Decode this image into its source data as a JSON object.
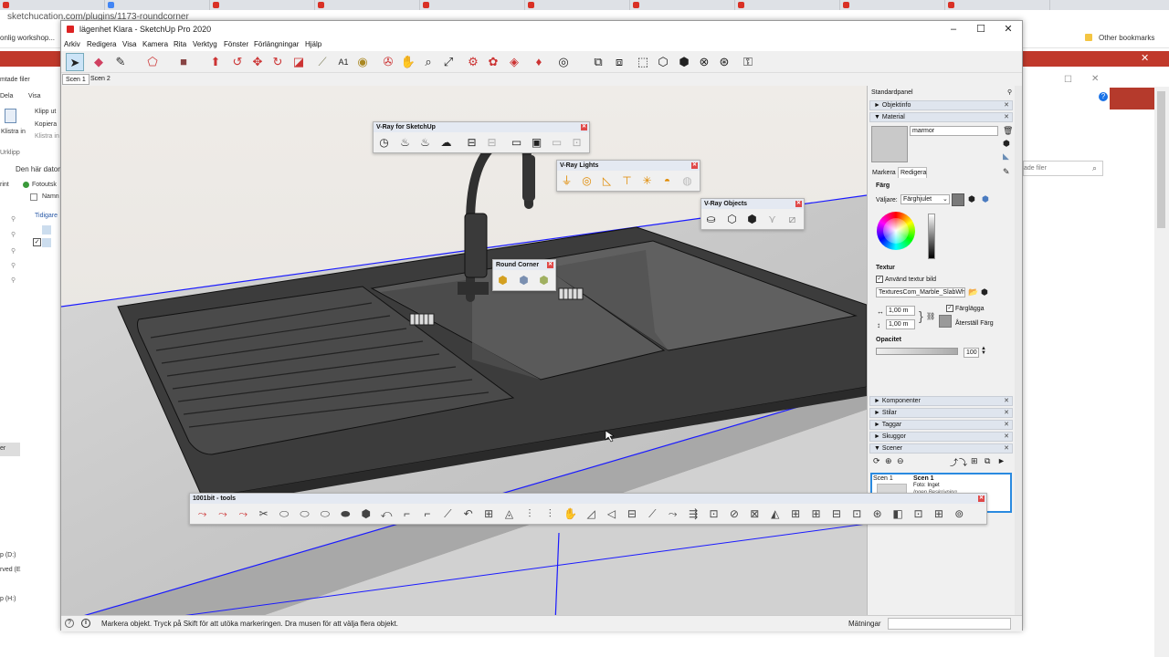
{
  "browser": {
    "url": "sketchucation.com/plugins/1173-roundcorner",
    "bookmarks_left": "onlig workshop...",
    "bookmarks_right": "Other bookmarks"
  },
  "explorer": {
    "header": "mtade filer",
    "ribbon_dela": "Dela",
    "ribbon_visa": "Visa",
    "klistra": "Klistra in",
    "klipp": "Klipp ut",
    "kopiera": "Kopiera",
    "klistra_in2": "Klistra in",
    "urklipp": "Urklipp",
    "den_har_datorn": "Den här dator",
    "rint": "rint",
    "fotoutsk": "Fotoutsk",
    "namn": "Namn",
    "tidigare": "Tidigare",
    "drive_d": "p (D:)",
    "drive_e": "rved (E",
    "drive_h": "p (H:)",
    "er": "er"
  },
  "right_bg": {
    "search_placeholder": "ade filer"
  },
  "sketchup": {
    "title": "lägenhet Klara - SketchUp Pro 2020",
    "menu": [
      "Arkiv",
      "Redigera",
      "Visa",
      "Kamera",
      "Rita",
      "Verktyg",
      "Fönster",
      "Förlängningar",
      "Hjälp"
    ],
    "scenes": [
      "Scen 1",
      "Scen 2"
    ],
    "status_text": "Markera objekt. Tryck på Skift för att utöka markeringen. Dra musen för att välja flera objekt.",
    "measurements_label": "Mätningar"
  },
  "toolbars": {
    "vray": "V-Ray for SketchUp",
    "vray_lights": "V-Ray Lights",
    "vray_objects": "V-Ray Objects",
    "round_corner": "Round Corner",
    "bit_tools": "1001bit - tools"
  },
  "tray": {
    "title": "Standardpanel",
    "sections_top": [
      "Objektinfo",
      "Material"
    ],
    "material_name": "marmor",
    "tabs": [
      "Markera",
      "Redigera"
    ],
    "farg_label": "Färg",
    "valjare_label": "Väljare:",
    "valjare_value": "Färghjulet",
    "textur_label": "Textur",
    "use_texture": "Använd textur bild",
    "texture_file": "TexturesCom_Marble_SlabWh",
    "width": "1,00 m",
    "height": "1,00 m",
    "fargagga": "Färglägga",
    "aterstall": "Återställ Färg",
    "opacitet": "Opacitet",
    "opacity_value": "100",
    "sections_bottom": [
      "Komponenter",
      "Stilar",
      "Taggar",
      "Skuggor",
      "Scener"
    ],
    "scene_card": {
      "thumb_label": "Scen 1",
      "name": "Scen 1",
      "foto": "Foto: Inget",
      "desc": "Ingen Beskrivning"
    }
  },
  "colors": {
    "title_red": "#c0392b",
    "toolbar_header": "#e4e9f2",
    "selection_blue": "#1a1aff",
    "vray_orange": "#e08a00"
  }
}
